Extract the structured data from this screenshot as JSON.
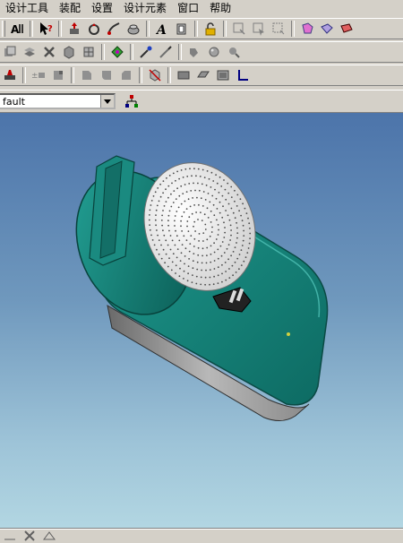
{
  "menubar": {
    "items": [
      "设计工具",
      "装配",
      "设置",
      "设计元素",
      "窗口",
      "帮助"
    ]
  },
  "toolbar_icons": {
    "row1": [
      "distance-measure-icon",
      "whats-this-help-icon",
      "extrude-icon",
      "revolve-icon",
      "sweep-icon",
      "loft-icon",
      "text-icon",
      "shell-icon",
      "lock-icon",
      "box-select-icon",
      "select-all-icon",
      "select-region-icon",
      "shade-icon",
      "wireframe-icon",
      "render-icon"
    ],
    "row2": [
      "copy-icon",
      "layer-icon",
      "tools-icon",
      "solid-icon",
      "assembly-icon",
      "snap-icon",
      "eyedropper-icon",
      "pick-icon",
      "paint-icon",
      "material-icon",
      "light-icon"
    ],
    "row3": [
      "stamp-icon",
      "dimension-icon",
      "face-icon",
      "edge-icon",
      "blend-icon",
      "chamfer-icon",
      "hide-icon",
      "view-front-icon",
      "view-side-icon",
      "view-iso-icon",
      "axis-icon"
    ]
  },
  "combo": {
    "value": "fault"
  },
  "colors": {
    "model_body": "#1a8a80",
    "viewport_top": "#4c74aa",
    "viewport_bottom": "#b2d6e2"
  }
}
